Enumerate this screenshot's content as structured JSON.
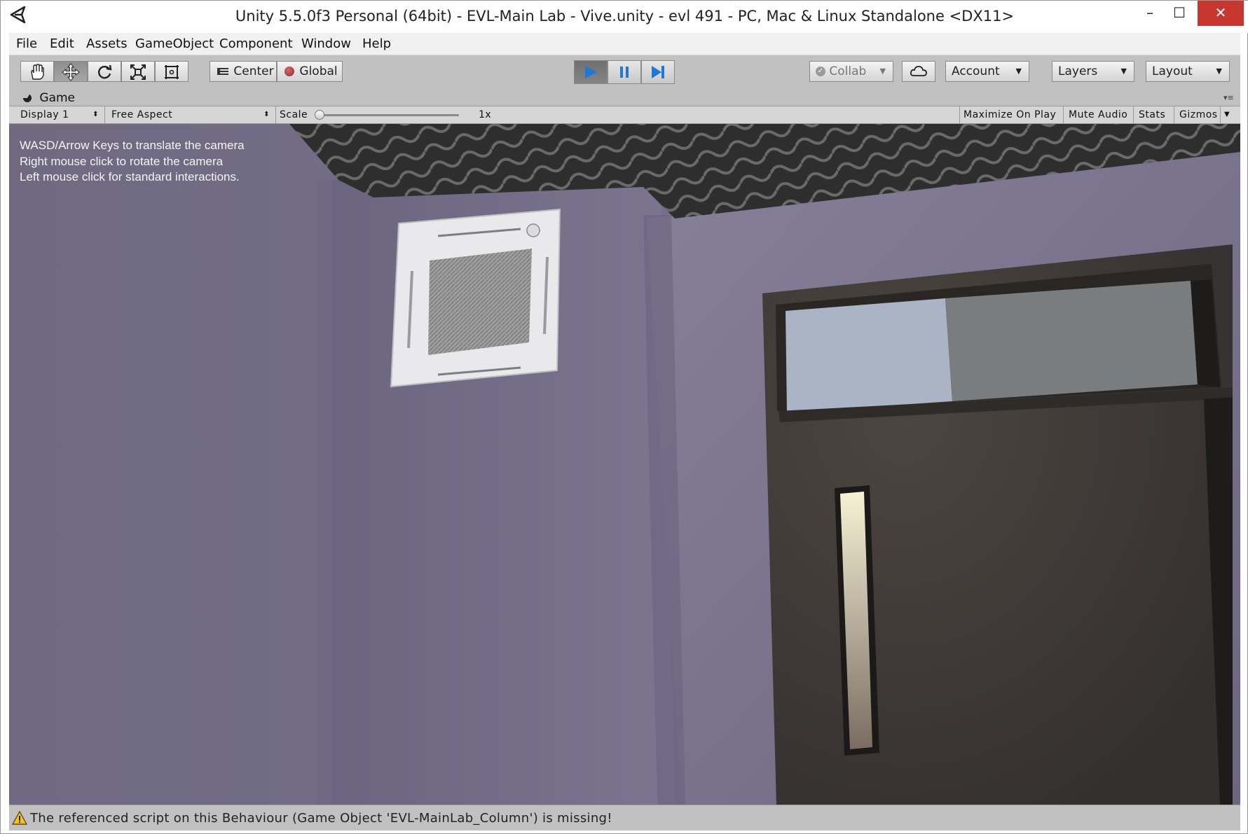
{
  "window": {
    "title": "Unity 5.5.0f3 Personal (64bit) - EVL-Main Lab - Vive.unity - evl 491 - PC, Mac & Linux Standalone <DX11>",
    "minimize_glyph": "–",
    "maximize_glyph": "☐",
    "close_glyph": "✕"
  },
  "menu": [
    "File",
    "Edit",
    "Assets",
    "GameObject",
    "Component",
    "Window",
    "Help"
  ],
  "toolbar": {
    "tools": [
      "hand-icon",
      "move-icon",
      "rotate-icon",
      "scale-icon",
      "rect-tool-icon"
    ],
    "active_tool": "move-icon",
    "pivot_mode": "Center",
    "pivot_rotation": "Global",
    "collab": "Collab",
    "account": "Account",
    "layers": "Layers",
    "layout": "Layout",
    "play_active": true
  },
  "game_panel": {
    "tab_label": "Game",
    "display": "Display 1",
    "aspect": "Free Aspect",
    "scale_label": "Scale",
    "scale_value": "1x",
    "maximize_on_play": "Maximize On Play",
    "mute_audio": "Mute Audio",
    "stats": "Stats",
    "gizmos": "Gizmos"
  },
  "hud": {
    "line1": "WASD/Arrow Keys to translate the camera",
    "line2": "Right mouse click to rotate the camera",
    "line3": "Left mouse click for standard interactions."
  },
  "status": {
    "message": "The referenced script on this Behaviour (Game Object 'EVL-MainLab_Column') is missing!"
  },
  "colors": {
    "wall": "#76708a",
    "door": "#3c3834",
    "toolbar_bg": "#c1c1c1",
    "play_blue": "#1f78d4",
    "close_red": "#c7372f"
  }
}
